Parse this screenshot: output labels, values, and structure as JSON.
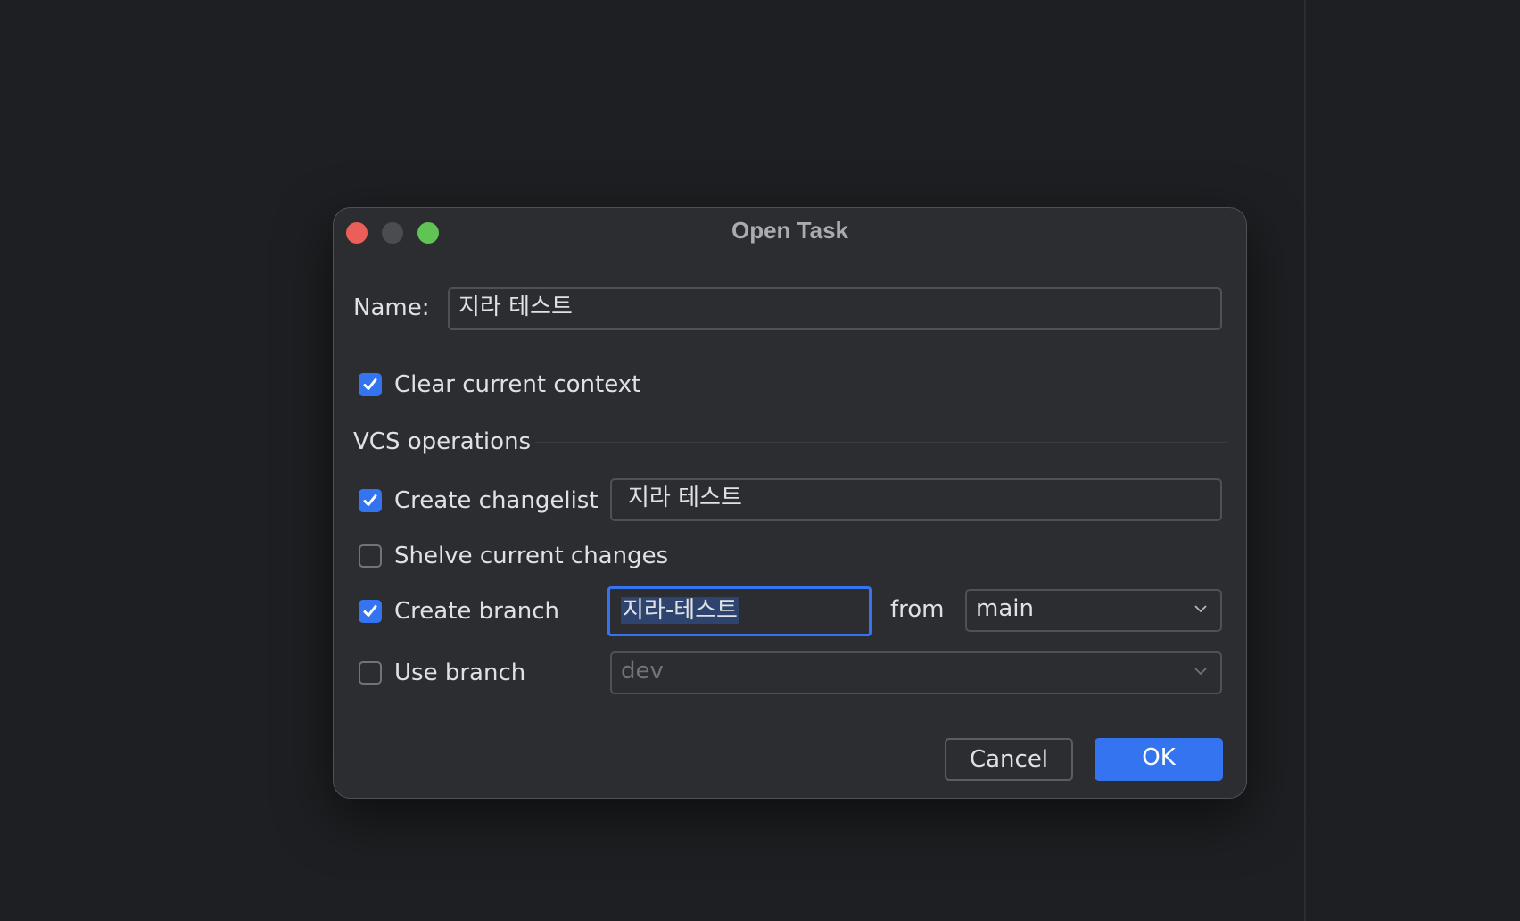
{
  "dialog": {
    "title": "Open Task",
    "name_label": "Name:",
    "name_value": "지라 테스트",
    "clear_context_label": "Clear current context",
    "clear_context_checked": true,
    "vcs_section_label": "VCS operations",
    "create_changelist_label": "Create changelist",
    "create_changelist_checked": true,
    "changelist_value": "지라 테스트",
    "shelve_label": "Shelve current changes",
    "shelve_checked": false,
    "create_branch_label": "Create branch",
    "create_branch_checked": true,
    "branch_value": "지라-테스트",
    "from_label": "from",
    "from_branch_value": "main",
    "use_branch_label": "Use branch",
    "use_branch_checked": false,
    "use_branch_value": "dev",
    "cancel_label": "Cancel",
    "ok_label": "OK"
  },
  "colors": {
    "accent": "#3574f0",
    "close": "#ec5f59",
    "maximize": "#5fc453"
  }
}
